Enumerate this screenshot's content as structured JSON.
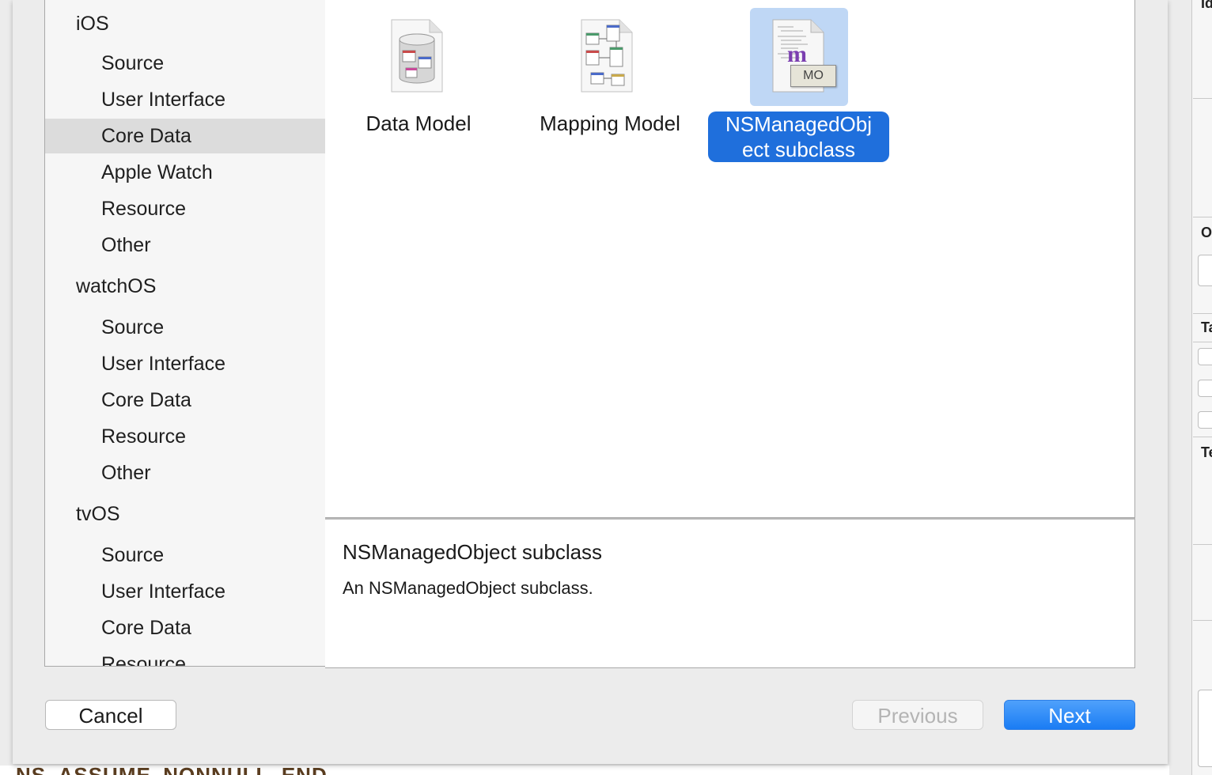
{
  "sidebar": {
    "items": [
      {
        "label": "iOS",
        "kind": "group"
      },
      {
        "label": "Source",
        "kind": "child"
      },
      {
        "label": "User Interface",
        "kind": "child"
      },
      {
        "label": "Core Data",
        "kind": "child",
        "selected": true
      },
      {
        "label": "Apple Watch",
        "kind": "child"
      },
      {
        "label": "Resource",
        "kind": "child"
      },
      {
        "label": "Other",
        "kind": "child"
      },
      {
        "label": "watchOS",
        "kind": "group"
      },
      {
        "label": "Source",
        "kind": "child"
      },
      {
        "label": "User Interface",
        "kind": "child"
      },
      {
        "label": "Core Data",
        "kind": "child"
      },
      {
        "label": "Resource",
        "kind": "child"
      },
      {
        "label": "Other",
        "kind": "child"
      },
      {
        "label": "tvOS",
        "kind": "group"
      },
      {
        "label": "Source",
        "kind": "child"
      },
      {
        "label": "User Interface",
        "kind": "child"
      },
      {
        "label": "Core Data",
        "kind": "child"
      },
      {
        "label": "Resource",
        "kind": "child"
      }
    ]
  },
  "templates": [
    {
      "label": "Data Model",
      "icon": "data-model-icon"
    },
    {
      "label": "Mapping Model",
      "icon": "mapping-model-icon"
    },
    {
      "label_line1": "NSManagedObj",
      "label_line2": "ect subclass",
      "icon": "managed-object-icon",
      "badge": "MO",
      "glyph": "m",
      "selected": true
    }
  ],
  "description": {
    "title": "NSManagedObject subclass",
    "body": "An NSManagedObject subclass."
  },
  "buttons": {
    "cancel": "Cancel",
    "previous": "Previous",
    "next": "Next"
  },
  "background": {
    "bottom_code": "NS_ASSUME_NONNULL_END",
    "right_letters": [
      "Id",
      "O",
      "Ta",
      "Te"
    ]
  },
  "colors": {
    "selection_blue": "#1f6fdc",
    "icon_selection": "#bfd7f5",
    "next_button": "#1a7cf4"
  }
}
